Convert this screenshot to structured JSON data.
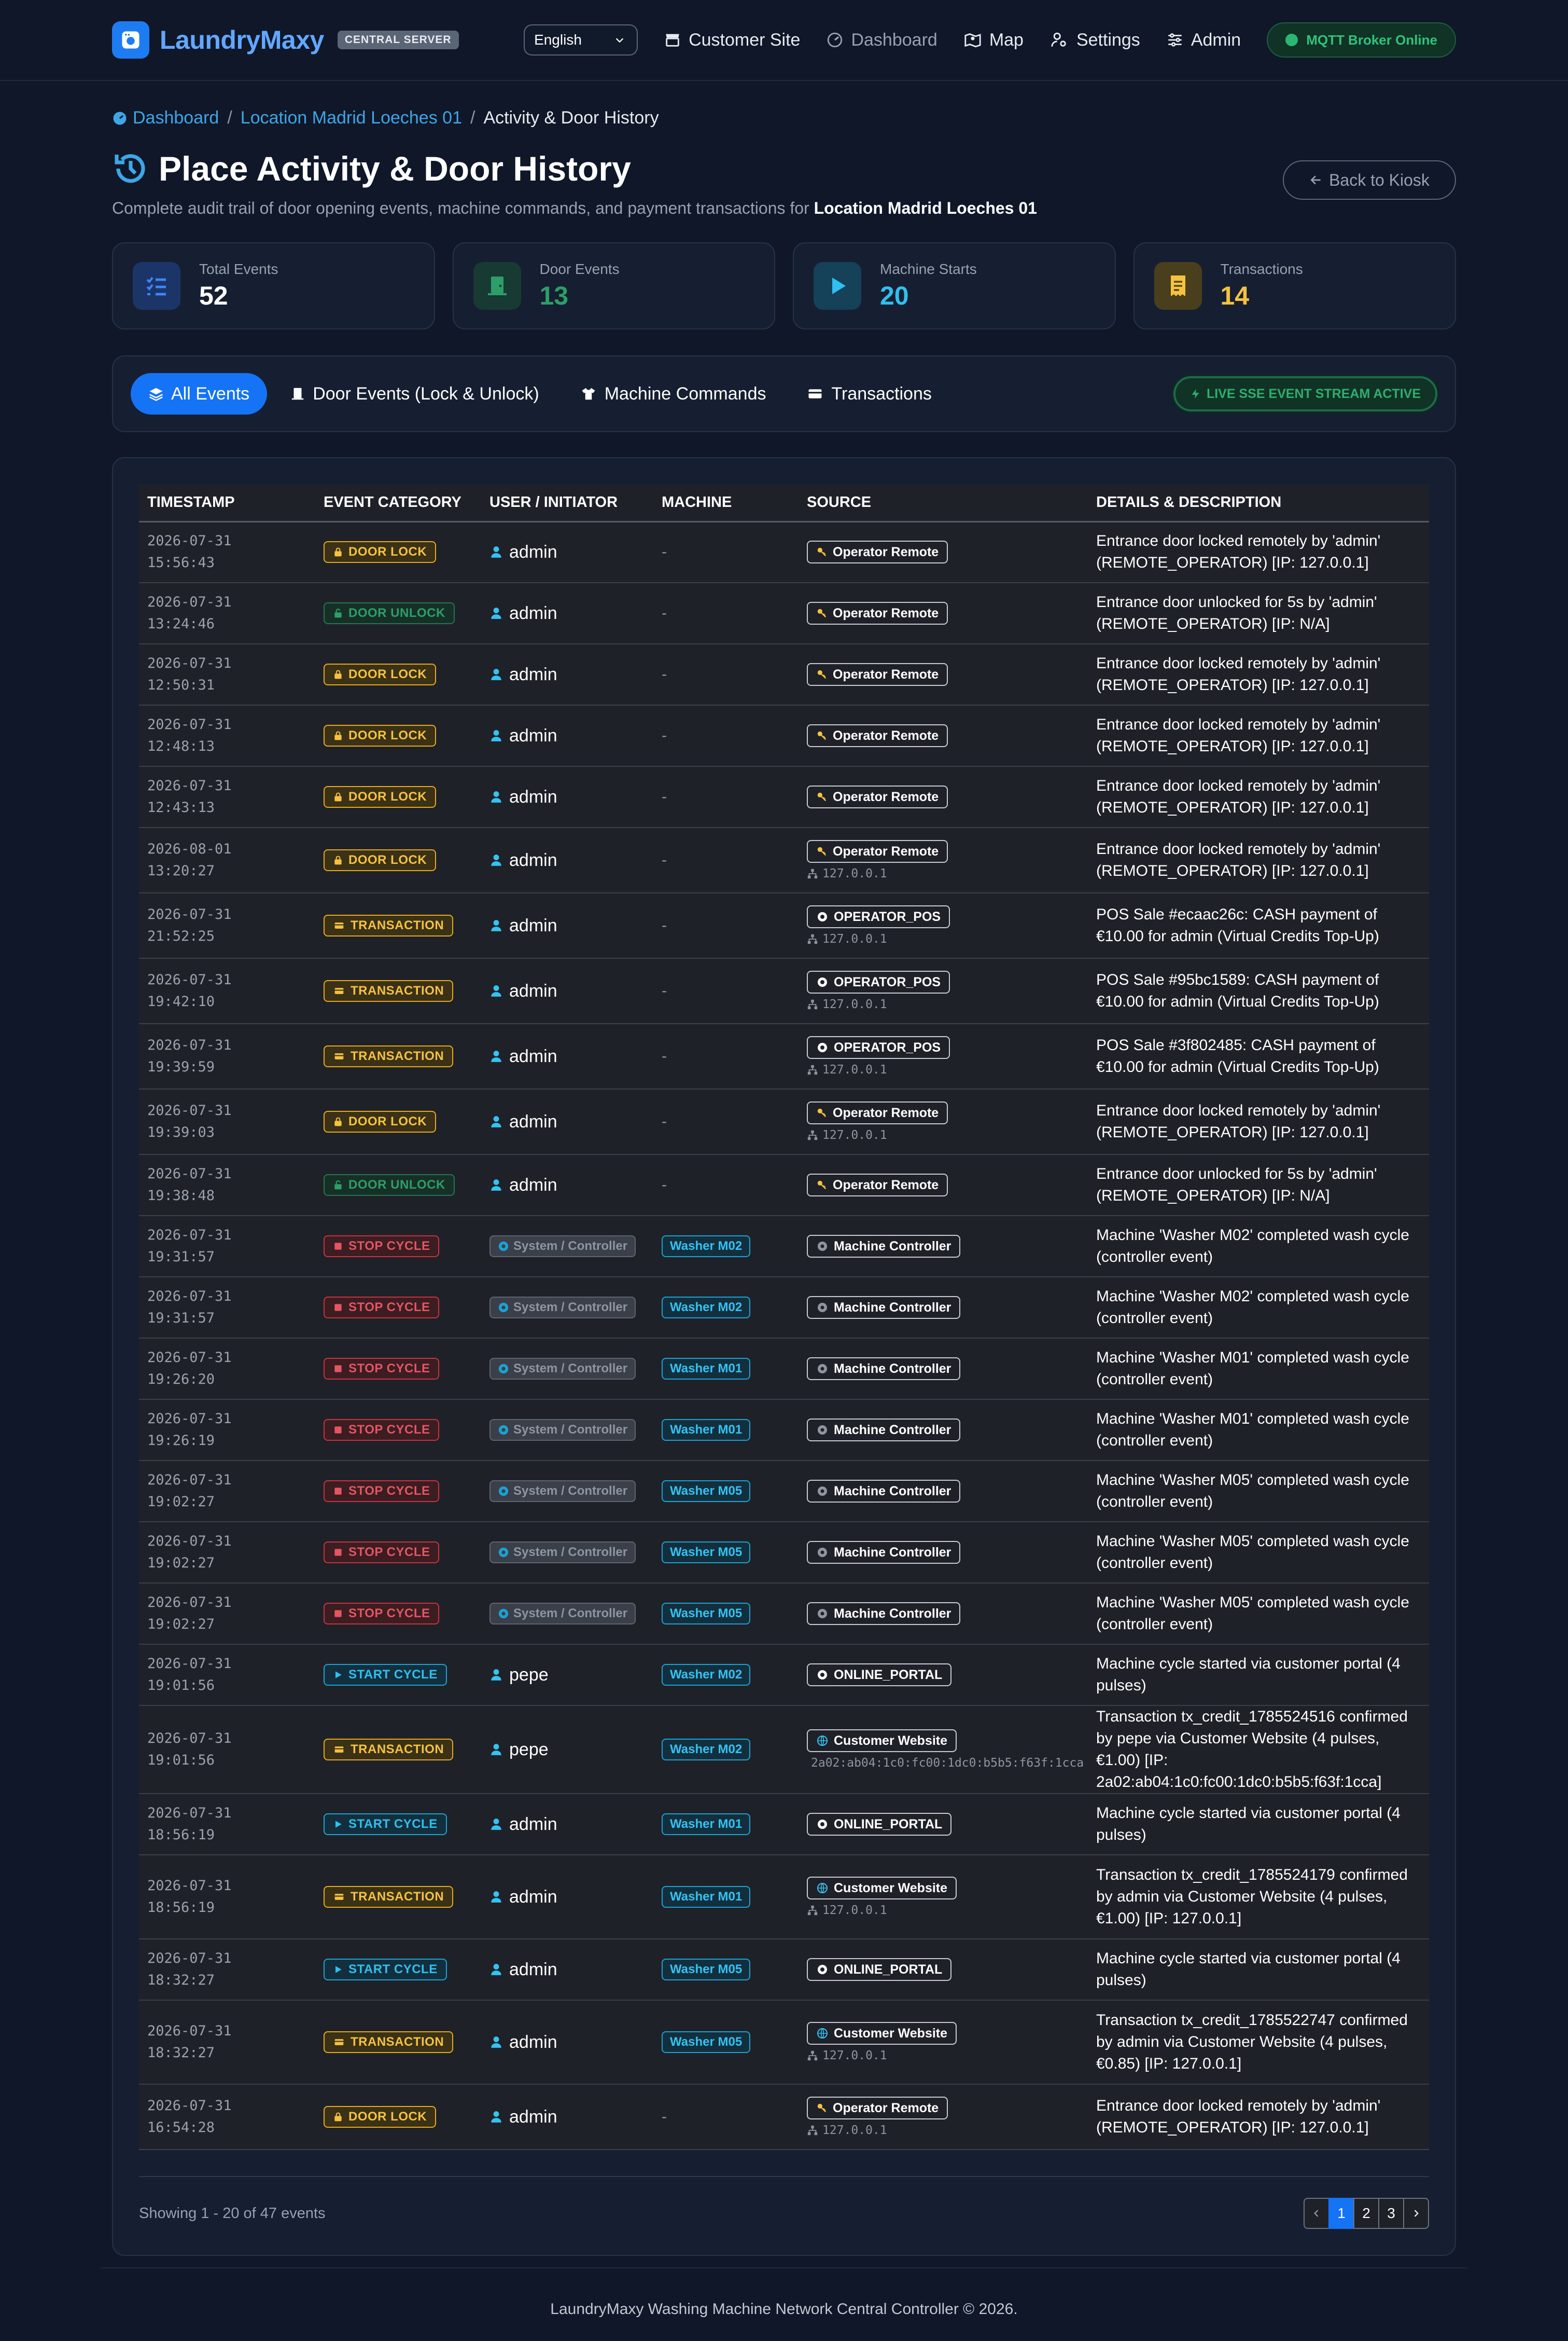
{
  "brand": {
    "name": "LaundryMaxy",
    "badge": "CENTRAL SERVER"
  },
  "nav": {
    "language": "English",
    "links": [
      "Customer Site",
      "Dashboard",
      "Map",
      "Settings",
      "Admin"
    ],
    "mqtt_status": "MQTT Broker Online"
  },
  "breadcrumb": {
    "home": "Dashboard",
    "location": "Location Madrid Loeches 01",
    "current": "Activity & Door History"
  },
  "header": {
    "title": "Place Activity & Door History",
    "subtitle": "Complete audit trail of door opening events, machine commands, and payment transactions for",
    "location": "Location Madrid Loeches 01",
    "back_label": "Back to Kiosk"
  },
  "stats": [
    {
      "label": "Total Events",
      "value": "52",
      "color": "#ffffff"
    },
    {
      "label": "Door Events",
      "value": "13",
      "color": "#2d9e68"
    },
    {
      "label": "Machine Starts",
      "value": "20",
      "color": "#2fc0ef"
    },
    {
      "label": "Transactions",
      "value": "14",
      "color": "#f6c23e"
    }
  ],
  "filters": {
    "tabs": [
      "All Events",
      "Door Events (Lock & Unlock)",
      "Machine Commands",
      "Transactions"
    ],
    "active": "All Events",
    "sse": "LIVE SSE EVENT STREAM ACTIVE"
  },
  "table": {
    "columns": [
      "TIMESTAMP",
      "EVENT CATEGORY",
      "USER / INITIATOR",
      "MACHINE",
      "SOURCE",
      "DETAILS & DESCRIPTION"
    ],
    "rows": [
      {
        "date": "2026-07-31",
        "time": "15:56:43",
        "category": "DOOR LOCK",
        "cat": "lock",
        "user": "admin",
        "user_type": "user",
        "machine": "-",
        "source": "Operator Remote",
        "src_icon": "key",
        "ip": "",
        "details": "Entrance door locked remotely by 'admin' (REMOTE_OPERATOR) [IP: 127.0.0.1]"
      },
      {
        "date": "2026-07-31",
        "time": "13:24:46",
        "category": "DOOR UNLOCK",
        "cat": "unlock",
        "user": "admin",
        "user_type": "user",
        "machine": "-",
        "source": "Operator Remote",
        "src_icon": "key",
        "ip": "",
        "details": "Entrance door unlocked for 5s by 'admin' (REMOTE_OPERATOR) [IP: N/A]"
      },
      {
        "date": "2026-07-31",
        "time": "12:50:31",
        "category": "DOOR LOCK",
        "cat": "lock",
        "user": "admin",
        "user_type": "user",
        "machine": "-",
        "source": "Operator Remote",
        "src_icon": "key",
        "ip": "",
        "details": "Entrance door locked remotely by 'admin' (REMOTE_OPERATOR) [IP: 127.0.0.1]"
      },
      {
        "date": "2026-07-31",
        "time": "12:48:13",
        "category": "DOOR LOCK",
        "cat": "lock",
        "user": "admin",
        "user_type": "user",
        "machine": "-",
        "source": "Operator Remote",
        "src_icon": "key",
        "ip": "",
        "details": "Entrance door locked remotely by 'admin' (REMOTE_OPERATOR) [IP: 127.0.0.1]"
      },
      {
        "date": "2026-07-31",
        "time": "12:43:13",
        "category": "DOOR LOCK",
        "cat": "lock",
        "user": "admin",
        "user_type": "user",
        "machine": "-",
        "source": "Operator Remote",
        "src_icon": "key",
        "ip": "",
        "details": "Entrance door locked remotely by 'admin' (REMOTE_OPERATOR) [IP: 127.0.0.1]"
      },
      {
        "date": "2026-08-01",
        "time": "13:20:27",
        "category": "DOOR LOCK",
        "cat": "lock",
        "user": "admin",
        "user_type": "user",
        "machine": "-",
        "source": "Operator Remote",
        "src_icon": "key",
        "ip": "127.0.0.1",
        "details": "Entrance door locked remotely by 'admin' (REMOTE_OPERATOR) [IP: 127.0.0.1]"
      },
      {
        "date": "2026-07-31",
        "time": "21:52:25",
        "category": "TRANSACTION",
        "cat": "tx",
        "user": "admin",
        "user_type": "user",
        "machine": "-",
        "source": "OPERATOR_POS",
        "src_icon": "gear",
        "ip": "127.0.0.1",
        "details": "POS Sale #ecaac26c: CASH payment of €10.00 for admin (Virtual Credits Top-Up)"
      },
      {
        "date": "2026-07-31",
        "time": "19:42:10",
        "category": "TRANSACTION",
        "cat": "tx",
        "user": "admin",
        "user_type": "user",
        "machine": "-",
        "source": "OPERATOR_POS",
        "src_icon": "gear",
        "ip": "127.0.0.1",
        "details": "POS Sale #95bc1589: CASH payment of €10.00 for admin (Virtual Credits Top-Up)"
      },
      {
        "date": "2026-07-31",
        "time": "19:39:59",
        "category": "TRANSACTION",
        "cat": "tx",
        "user": "admin",
        "user_type": "user",
        "machine": "-",
        "source": "OPERATOR_POS",
        "src_icon": "gear",
        "ip": "127.0.0.1",
        "details": "POS Sale #3f802485: CASH payment of €10.00 for admin (Virtual Credits Top-Up)"
      },
      {
        "date": "2026-07-31",
        "time": "19:39:03",
        "category": "DOOR LOCK",
        "cat": "lock",
        "user": "admin",
        "user_type": "user",
        "machine": "-",
        "source": "Operator Remote",
        "src_icon": "key",
        "ip": "127.0.0.1",
        "details": "Entrance door locked remotely by 'admin' (REMOTE_OPERATOR) [IP: 127.0.0.1]"
      },
      {
        "date": "2026-07-31",
        "time": "19:38:48",
        "category": "DOOR UNLOCK",
        "cat": "unlock",
        "user": "admin",
        "user_type": "user",
        "machine": "-",
        "source": "Operator Remote",
        "src_icon": "key",
        "ip": "",
        "details": "Entrance door unlocked for 5s by 'admin' (REMOTE_OPERATOR) [IP: N/A]"
      },
      {
        "date": "2026-07-31",
        "time": "19:31:57",
        "category": "STOP CYCLE",
        "cat": "stop",
        "user": "System / Controller",
        "user_type": "system",
        "machine": "Washer M02",
        "source": "Machine Controller",
        "src_icon": "chip",
        "ip": "",
        "details": "Machine 'Washer M02' completed wash cycle (controller event)"
      },
      {
        "date": "2026-07-31",
        "time": "19:31:57",
        "category": "STOP CYCLE",
        "cat": "stop",
        "user": "System / Controller",
        "user_type": "system",
        "machine": "Washer M02",
        "source": "Machine Controller",
        "src_icon": "chip",
        "ip": "",
        "details": "Machine 'Washer M02' completed wash cycle (controller event)"
      },
      {
        "date": "2026-07-31",
        "time": "19:26:20",
        "category": "STOP CYCLE",
        "cat": "stop",
        "user": "System / Controller",
        "user_type": "system",
        "machine": "Washer M01",
        "source": "Machine Controller",
        "src_icon": "chip",
        "ip": "",
        "details": "Machine 'Washer M01' completed wash cycle (controller event)"
      },
      {
        "date": "2026-07-31",
        "time": "19:26:19",
        "category": "STOP CYCLE",
        "cat": "stop",
        "user": "System / Controller",
        "user_type": "system",
        "machine": "Washer M01",
        "source": "Machine Controller",
        "src_icon": "chip",
        "ip": "",
        "details": "Machine 'Washer M01' completed wash cycle (controller event)"
      },
      {
        "date": "2026-07-31",
        "time": "19:02:27",
        "category": "STOP CYCLE",
        "cat": "stop",
        "user": "System / Controller",
        "user_type": "system",
        "machine": "Washer M05",
        "source": "Machine Controller",
        "src_icon": "chip",
        "ip": "",
        "details": "Machine 'Washer M05' completed wash cycle (controller event)"
      },
      {
        "date": "2026-07-31",
        "time": "19:02:27",
        "category": "STOP CYCLE",
        "cat": "stop",
        "user": "System / Controller",
        "user_type": "system",
        "machine": "Washer M05",
        "source": "Machine Controller",
        "src_icon": "chip",
        "ip": "",
        "details": "Machine 'Washer M05' completed wash cycle (controller event)"
      },
      {
        "date": "2026-07-31",
        "time": "19:02:27",
        "category": "STOP CYCLE",
        "cat": "stop",
        "user": "System / Controller",
        "user_type": "system",
        "machine": "Washer M05",
        "source": "Machine Controller",
        "src_icon": "chip",
        "ip": "",
        "details": "Machine 'Washer M05' completed wash cycle (controller event)"
      },
      {
        "date": "2026-07-31",
        "time": "19:01:56",
        "category": "START CYCLE",
        "cat": "start",
        "user": "pepe",
        "user_type": "user",
        "machine": "Washer M02",
        "source": "ONLINE_PORTAL",
        "src_icon": "gear",
        "ip": "",
        "details": "Machine cycle started via customer portal (4 pulses)"
      },
      {
        "date": "2026-07-31",
        "time": "19:01:56",
        "category": "TRANSACTION",
        "cat": "tx",
        "user": "pepe",
        "user_type": "user",
        "machine": "Washer M02",
        "source": "Customer Website",
        "src_icon": "globe",
        "ip": "2a02:ab04:1c0:fc00:1dc0:b5b5:f63f:1cca",
        "details": "Transaction tx_credit_1785524516 confirmed by pepe via Customer Website (4 pulses, €1.00) [IP: 2a02:ab04:1c0:fc00:1dc0:b5b5:f63f:1cca]"
      },
      {
        "date": "2026-07-31",
        "time": "18:56:19",
        "category": "START CYCLE",
        "cat": "start",
        "user": "admin",
        "user_type": "user",
        "machine": "Washer M01",
        "source": "ONLINE_PORTAL",
        "src_icon": "gear",
        "ip": "",
        "details": "Machine cycle started via customer portal (4 pulses)"
      },
      {
        "date": "2026-07-31",
        "time": "18:56:19",
        "category": "TRANSACTION",
        "cat": "tx",
        "user": "admin",
        "user_type": "user",
        "machine": "Washer M01",
        "source": "Customer Website",
        "src_icon": "globe",
        "ip": "127.0.0.1",
        "details": "Transaction tx_credit_1785524179 confirmed by admin via Customer Website (4 pulses, €1.00) [IP: 127.0.0.1]"
      },
      {
        "date": "2026-07-31",
        "time": "18:32:27",
        "category": "START CYCLE",
        "cat": "start",
        "user": "admin",
        "user_type": "user",
        "machine": "Washer M05",
        "source": "ONLINE_PORTAL",
        "src_icon": "gear",
        "ip": "",
        "details": "Machine cycle started via customer portal (4 pulses)"
      },
      {
        "date": "2026-07-31",
        "time": "18:32:27",
        "category": "TRANSACTION",
        "cat": "tx",
        "user": "admin",
        "user_type": "user",
        "machine": "Washer M05",
        "source": "Customer Website",
        "src_icon": "globe",
        "ip": "127.0.0.1",
        "details": "Transaction tx_credit_1785522747 confirmed by admin via Customer Website (4 pulses, €0.85) [IP: 127.0.0.1]"
      },
      {
        "date": "2026-07-31",
        "time": "16:54:28",
        "category": "DOOR LOCK",
        "cat": "lock",
        "user": "admin",
        "user_type": "user",
        "machine": "-",
        "source": "Operator Remote",
        "src_icon": "key",
        "ip": "127.0.0.1",
        "details": "Entrance door locked remotely by 'admin' (REMOTE_OPERATOR) [IP: 127.0.0.1]"
      }
    ]
  },
  "pagination": {
    "showing": "Showing 1 - 20 of 47 events",
    "pages": [
      "1",
      "2",
      "3"
    ],
    "active": "1"
  },
  "footer": "LaundryMaxy Washing Machine Network Central Controller © 2026."
}
